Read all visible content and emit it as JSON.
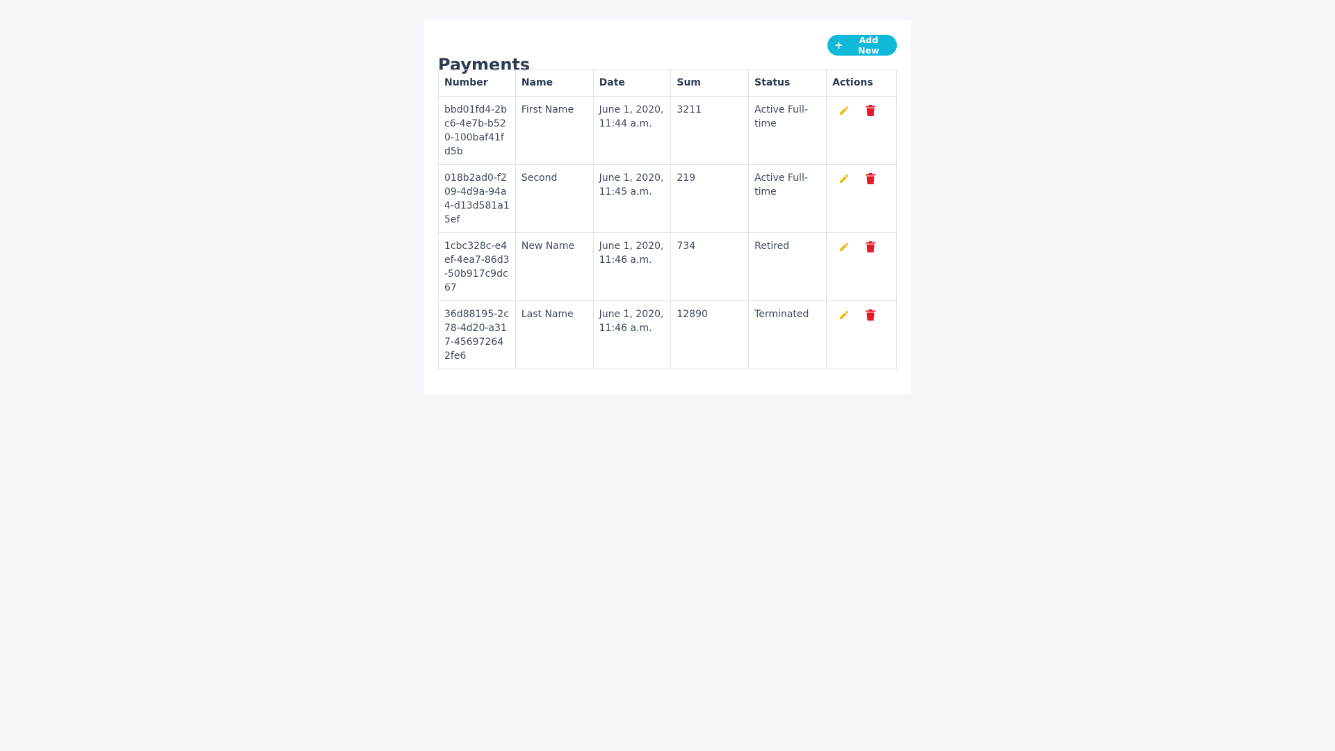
{
  "page": {
    "title": "Payments",
    "add_button_label": "Add New"
  },
  "colors": {
    "accent": "#11b9d9",
    "edit_icon": "#f5b400",
    "delete_icon": "#e8172b",
    "background": "#f4f6fa",
    "card": "#ffffff"
  },
  "icons": {
    "add": "plus-icon",
    "edit": "pencil-icon",
    "delete": "trash-icon"
  },
  "table": {
    "headers": [
      "Number",
      "Name",
      "Date",
      "Sum",
      "Status",
      "Actions"
    ],
    "rows": [
      {
        "number": "bbd01fd4-2bc6-4e7b-b520-100baf41fd5b",
        "name": "First Name",
        "date": "June 1, 2020, 11:44 a.m.",
        "sum": "3211",
        "status": "Active Full-time"
      },
      {
        "number": "018b2ad0-f209-4d9a-94a4-d13d581a15ef",
        "name": "Second",
        "date": "June 1, 2020, 11:45 a.m.",
        "sum": "219",
        "status": "Active Full-time"
      },
      {
        "number": "1cbc328c-e4ef-4ea7-86d3-50b917c9dc67",
        "name": "New Name",
        "date": "June 1, 2020, 11:46 a.m.",
        "sum": "734",
        "status": "Retired"
      },
      {
        "number": "36d88195-2c78-4d20-a317-456972642fe6",
        "name": "Last Name",
        "date": "June 1, 2020, 11:46 a.m.",
        "sum": "12890",
        "status": "Terminated"
      }
    ]
  }
}
